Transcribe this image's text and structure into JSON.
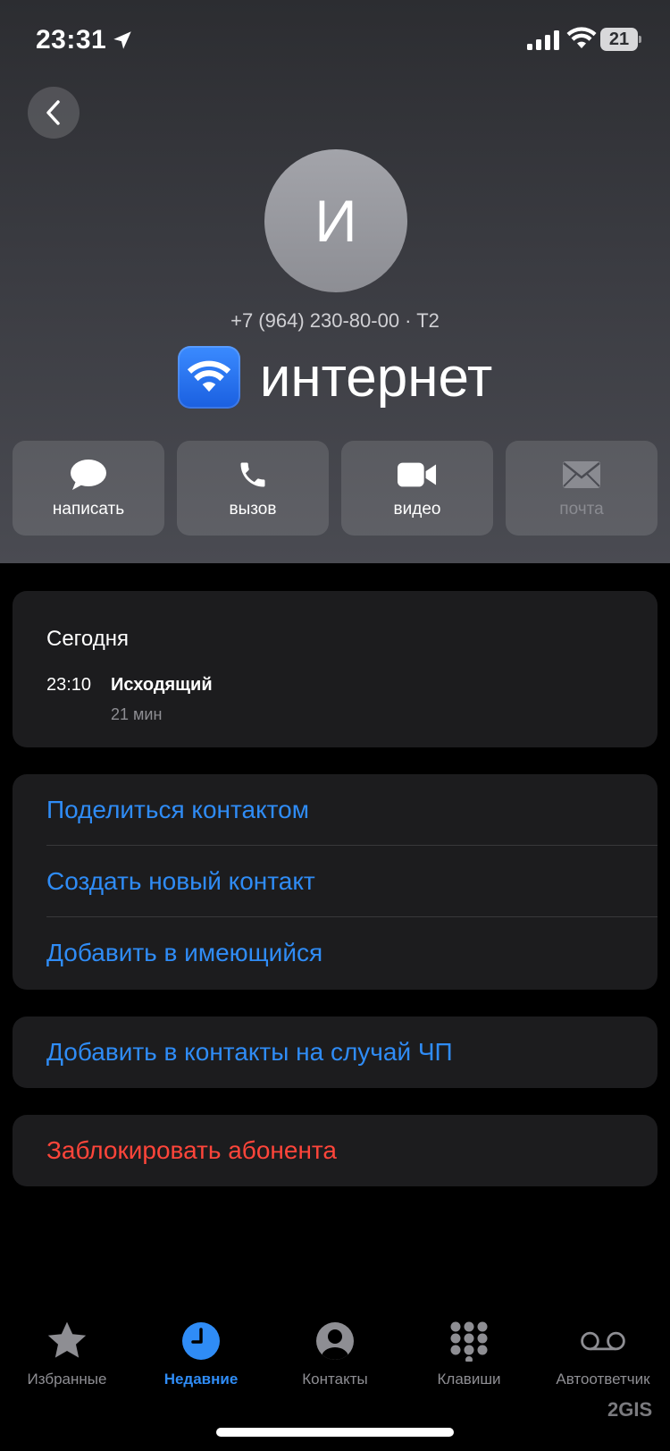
{
  "status_bar": {
    "time": "23:31",
    "battery": "21"
  },
  "contact": {
    "avatar_initial": "И",
    "phone_line": "+7 (964) 230-80-00 · T2",
    "name": "интернет"
  },
  "actions": [
    {
      "label": "написать",
      "icon": "message-bubble-icon",
      "enabled": true
    },
    {
      "label": "вызов",
      "icon": "phone-icon",
      "enabled": true
    },
    {
      "label": "видео",
      "icon": "video-camera-icon",
      "enabled": true
    },
    {
      "label": "почта",
      "icon": "mail-envelope-icon",
      "enabled": false
    }
  ],
  "recent": {
    "day": "Сегодня",
    "time": "23:10",
    "type": "Исходящий",
    "duration": "21 мин"
  },
  "contact_options": [
    "Поделиться контактом",
    "Создать новый контакт",
    "Добавить в имеющийся"
  ],
  "emergency_option": "Добавить в контакты на случай ЧП",
  "block_option": "Заблокировать абонента",
  "tabs": [
    {
      "label": "Избранные",
      "icon": "star-icon",
      "active": false
    },
    {
      "label": "Недавние",
      "icon": "clock-icon",
      "active": true
    },
    {
      "label": "Контакты",
      "icon": "person-circle-icon",
      "active": false
    },
    {
      "label": "Клавиши",
      "icon": "keypad-icon",
      "active": false
    },
    {
      "label": "Автоответчик",
      "icon": "voicemail-icon",
      "active": false
    }
  ],
  "colors": {
    "accent": "#2f8cf6",
    "danger": "#ff453a",
    "card": "#1c1c1e"
  },
  "watermark": "2GIS"
}
